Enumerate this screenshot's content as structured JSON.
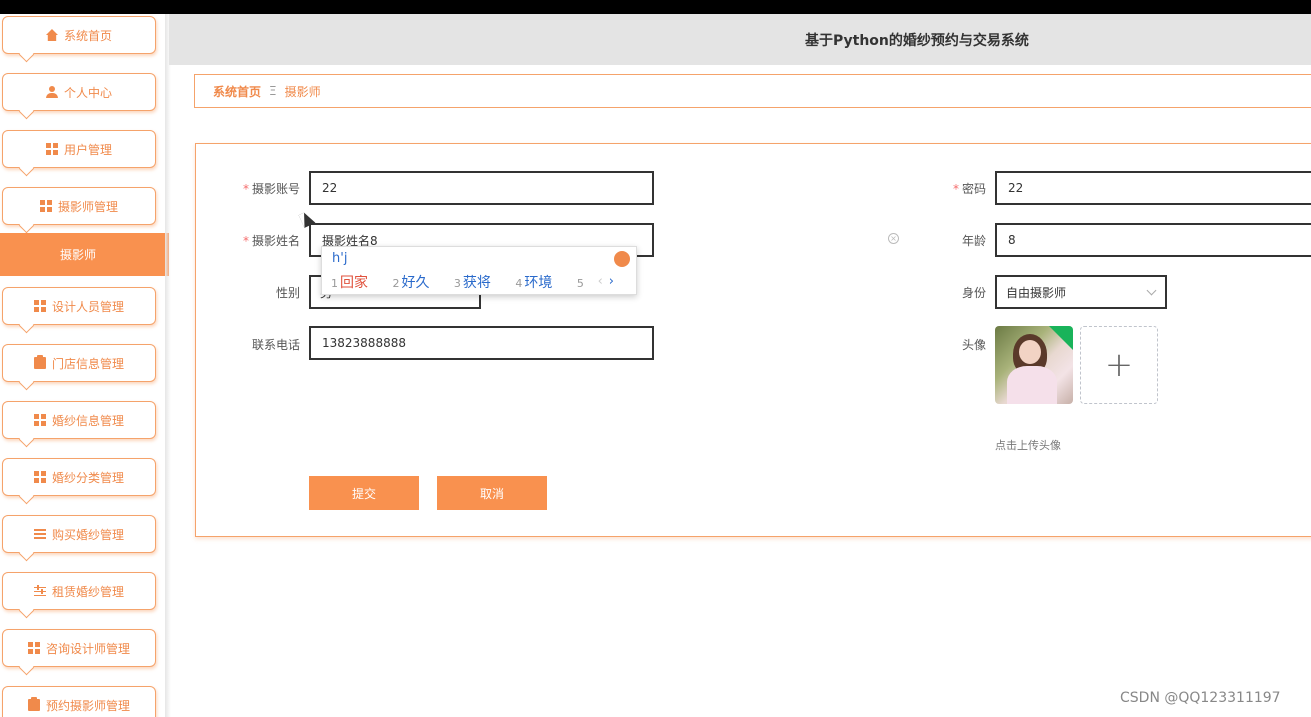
{
  "header": {
    "title": "基于Python的婚纱预约与交易系统"
  },
  "sidebar": {
    "items": [
      {
        "label": "系统首页",
        "icon": "home-icon"
      },
      {
        "label": "个人中心",
        "icon": "user-icon"
      },
      {
        "label": "用户管理",
        "icon": "grid-icon"
      },
      {
        "label": "摄影师管理",
        "icon": "grid-icon"
      },
      {
        "label": "设计人员管理",
        "icon": "grid-icon"
      },
      {
        "label": "门店信息管理",
        "icon": "clipboard-icon"
      },
      {
        "label": "婚纱信息管理",
        "icon": "grid-icon"
      },
      {
        "label": "婚纱分类管理",
        "icon": "grid-icon"
      },
      {
        "label": "购买婚纱管理",
        "icon": "list-icon"
      },
      {
        "label": "租赁婚纱管理",
        "icon": "slider-icon"
      },
      {
        "label": "咨询设计师管理",
        "icon": "grid-icon"
      },
      {
        "label": "预约摄影师管理",
        "icon": "clipboard-icon"
      }
    ],
    "active_sub": "摄影师"
  },
  "breadcrumb": {
    "home": "系统首页",
    "separator": "Ξ",
    "current": "摄影师"
  },
  "form": {
    "account": {
      "label": "摄影账号",
      "value": "22",
      "required": "*"
    },
    "name": {
      "label": "摄影姓名",
      "value": "摄影姓名8",
      "required": "*"
    },
    "gender": {
      "label": "性别",
      "value": "男"
    },
    "phone": {
      "label": "联系电话",
      "value": "13823888888"
    },
    "password": {
      "label": "密码",
      "value": "22",
      "required": "*"
    },
    "age": {
      "label": "年龄",
      "value": "8"
    },
    "identity": {
      "label": "身份",
      "value": "自由摄影师"
    },
    "avatar": {
      "label": "头像",
      "hint": "点击上传头像",
      "plus": "+"
    },
    "submit_label": "提交",
    "cancel_label": "取消"
  },
  "ime": {
    "composition": "h'j",
    "candidates": [
      {
        "num": "1",
        "text": "回家"
      },
      {
        "num": "2",
        "text": "好久"
      },
      {
        "num": "3",
        "text": "获将"
      },
      {
        "num": "4",
        "text": "环境"
      },
      {
        "num": "5",
        "text": ""
      }
    ],
    "nav_prev": "‹",
    "nav_next": "›"
  },
  "clear_icon_glyph": "×",
  "watermark": "CSDN @QQ123311197",
  "colors": {
    "accent": "#f9914f",
    "border": "#f5a36b",
    "header_bg": "#e4e4e4"
  }
}
